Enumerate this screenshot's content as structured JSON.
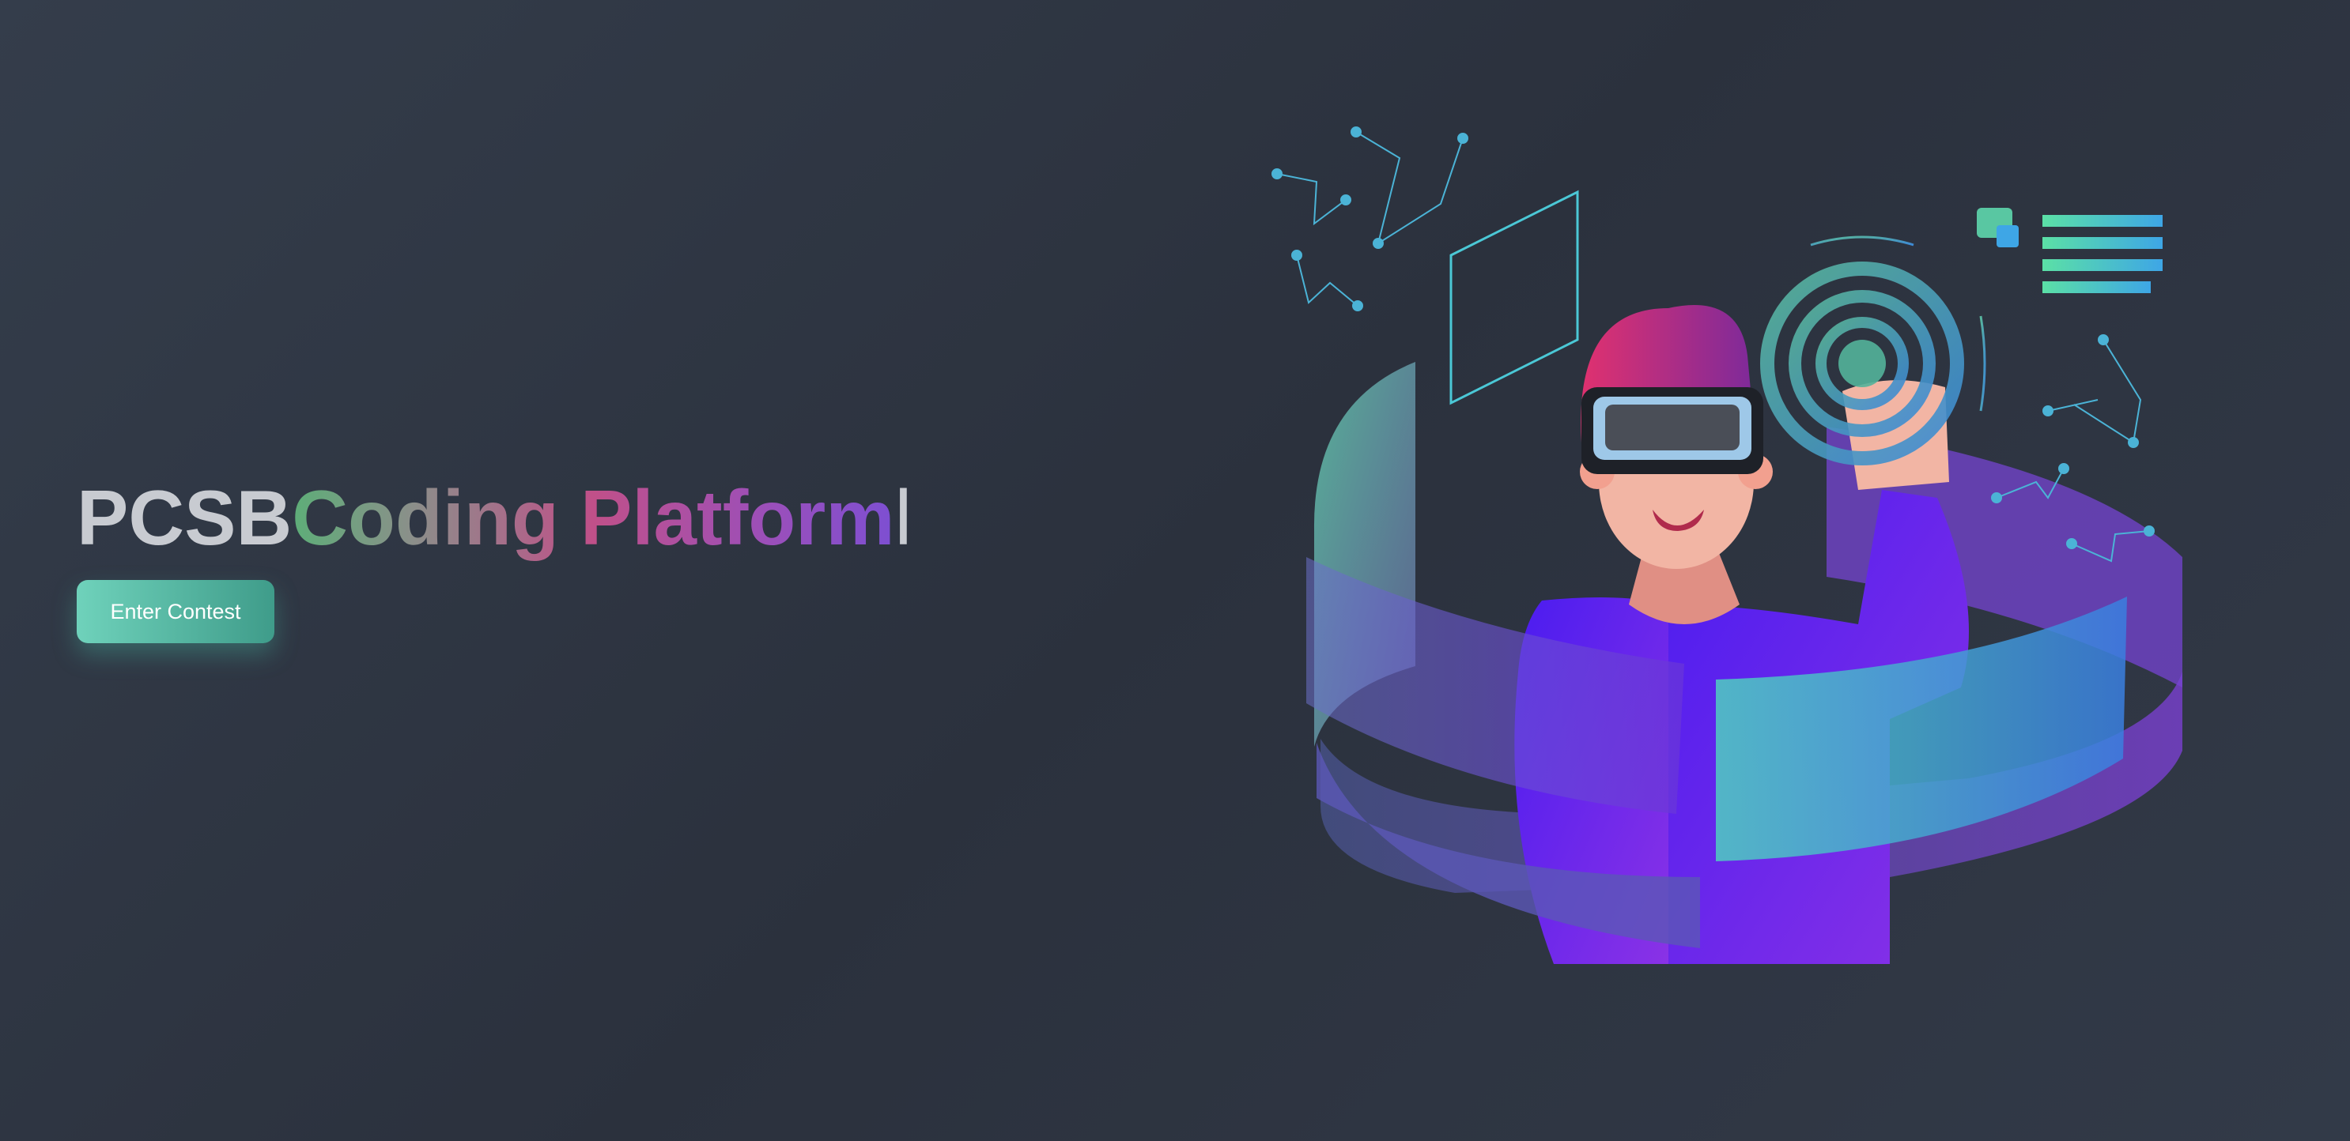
{
  "hero": {
    "title_prefix": "PCSB",
    "title_highlight": "Coding Platform",
    "title_cursor": "l",
    "cta_label": "Enter Contest"
  },
  "colors": {
    "background": "#2e3440",
    "accent_teal": "#5fc7b1",
    "accent_purple": "#7a35e6",
    "accent_magenta": "#d0307a",
    "accent_blue": "#3ea6e6"
  },
  "illustration": {
    "icons": [
      "vr-headset-person-icon",
      "ripple-target-icon",
      "constellation-icon",
      "panel-frame-icon",
      "list-lines-icon"
    ]
  }
}
